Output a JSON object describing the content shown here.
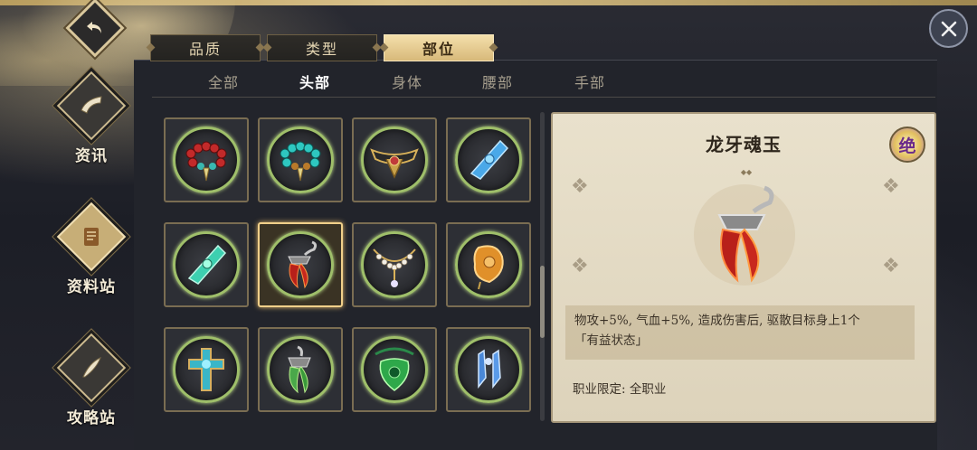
{
  "header": {
    "back_icon": "back-arrow-icon",
    "close_icon": "close-icon"
  },
  "sidebar": {
    "items": [
      {
        "label": "资讯",
        "icon": "horn-icon",
        "active": false
      },
      {
        "label": "资料站",
        "icon": "scroll-icon",
        "active": true
      },
      {
        "label": "攻略站",
        "icon": "quill-icon",
        "active": false
      }
    ]
  },
  "top_tabs": [
    {
      "label": "品质",
      "active": false
    },
    {
      "label": "类型",
      "active": false
    },
    {
      "label": "部位",
      "active": true
    }
  ],
  "sub_tabs": [
    {
      "label": "全部",
      "active": false
    },
    {
      "label": "头部",
      "active": true
    },
    {
      "label": "身体",
      "active": false
    },
    {
      "label": "腰部",
      "active": false
    },
    {
      "label": "手部",
      "active": false
    }
  ],
  "grid": {
    "items": [
      {
        "icon": "red-bead-necklace-icon",
        "selected": false
      },
      {
        "icon": "cyan-bead-necklace-icon",
        "selected": false
      },
      {
        "icon": "golden-circlet-icon",
        "selected": false
      },
      {
        "icon": "blue-crystal-pendant-icon",
        "selected": false
      },
      {
        "icon": "green-crystal-pendant-icon",
        "selected": false
      },
      {
        "icon": "red-fang-jade-icon",
        "selected": true
      },
      {
        "icon": "pearl-necklace-icon",
        "selected": false
      },
      {
        "icon": "amber-jade-icon",
        "selected": false
      },
      {
        "icon": "cross-amulet-icon",
        "selected": false
      },
      {
        "icon": "green-fang-icon",
        "selected": false
      },
      {
        "icon": "emerald-dragon-pendant-icon",
        "selected": false
      },
      {
        "icon": "blue-crystal-earring-icon",
        "selected": false
      }
    ]
  },
  "detail": {
    "title": "龙牙魂玉",
    "quality": "绝",
    "desc_line1": "物攻+5%, 气血+5%, 造成伤害后, 驱散目标身上1个",
    "desc_line2": "「有益状态」",
    "job_restriction": "职业限定: 全职业"
  },
  "colors": {
    "accent_gold": "#f1d08a",
    "active_tab": "#d8b97a",
    "card_bg": "#e9e1cc"
  }
}
